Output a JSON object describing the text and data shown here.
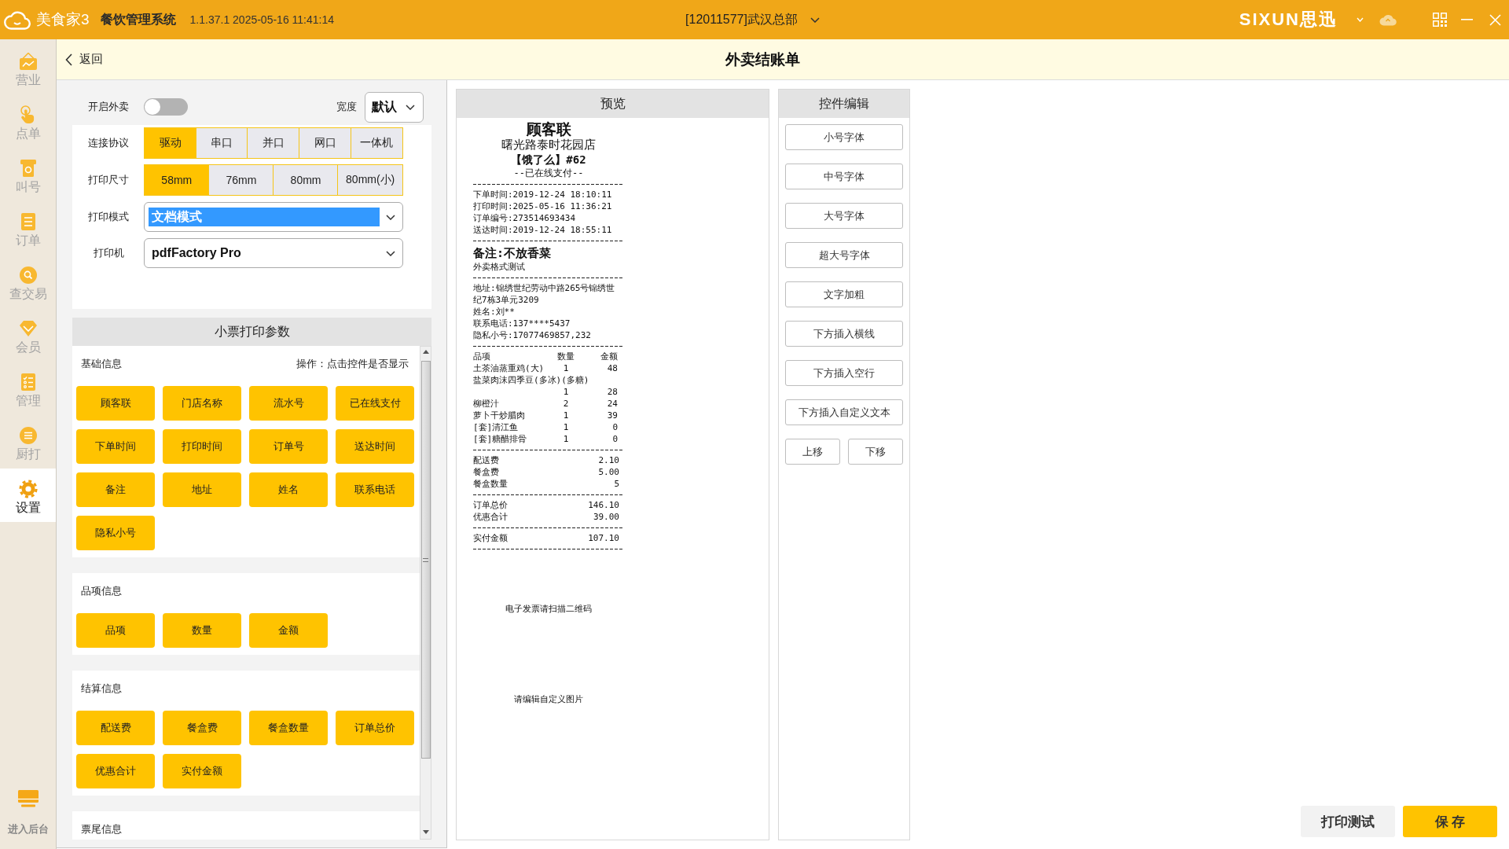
{
  "titlebar": {
    "app_name": "美食家3",
    "system_name": "餐饮管理系统",
    "version": "1.1.37.1 2025-05-16 11:41:14",
    "store": "[12011577]武汉总部",
    "brand": "SIXUN思迅"
  },
  "sidebar": {
    "items": [
      {
        "label": "营业",
        "selected": false
      },
      {
        "label": "点单",
        "selected": false
      },
      {
        "label": "叫号",
        "selected": false
      },
      {
        "label": "订单",
        "selected": false
      },
      {
        "label": "查交易",
        "selected": false
      },
      {
        "label": "会员",
        "selected": false
      },
      {
        "label": "管理",
        "selected": false
      },
      {
        "label": "厨打",
        "selected": false
      },
      {
        "label": "设置",
        "selected": true
      }
    ],
    "footer": {
      "label": "进入后台"
    }
  },
  "header": {
    "back": "返回",
    "title": "外卖结账单"
  },
  "settings": {
    "takeout": {
      "label": "开启外卖",
      "on": false
    },
    "width": {
      "label": "宽度",
      "value": "默认"
    },
    "protocol": {
      "label": "连接协议",
      "options": [
        {
          "label": "驱动",
          "selected": true
        },
        {
          "label": "串口",
          "selected": false
        },
        {
          "label": "并口",
          "selected": false
        },
        {
          "label": "网口",
          "selected": false
        },
        {
          "label": "一体机",
          "selected": false
        }
      ]
    },
    "size": {
      "label": "打印尺寸",
      "options": [
        {
          "label": "58mm",
          "selected": true
        },
        {
          "label": "76mm",
          "selected": false
        },
        {
          "label": "80mm",
          "selected": false
        },
        {
          "label": "80mm(小)",
          "selected": false
        }
      ]
    },
    "mode": {
      "label": "打印模式",
      "value": "文档模式",
      "highlighted": true
    },
    "printer": {
      "label": "打印机",
      "value": "pdfFactory Pro"
    }
  },
  "params": {
    "title": "小票打印参数",
    "groups": [
      {
        "title": "基础信息",
        "hint": "操作：点击控件是否显示",
        "buttons": [
          {
            "label": "顾客联",
            "on": true
          },
          {
            "label": "门店名称",
            "on": true
          },
          {
            "label": "流水号",
            "on": true
          },
          {
            "label": "已在线支付",
            "on": true
          },
          {
            "label": "下单时间",
            "on": true
          },
          {
            "label": "打印时间",
            "on": true
          },
          {
            "label": "订单号",
            "on": true
          },
          {
            "label": "送达时间",
            "on": true
          },
          {
            "label": "备注",
            "on": true
          },
          {
            "label": "地址",
            "on": true
          },
          {
            "label": "姓名",
            "on": true
          },
          {
            "label": "联系电话",
            "on": true
          },
          {
            "label": "隐私小号",
            "on": true
          }
        ]
      },
      {
        "title": "品项信息",
        "buttons": [
          {
            "label": "品项",
            "on": true
          },
          {
            "label": "数量",
            "on": true
          },
          {
            "label": "金额",
            "on": true
          }
        ]
      },
      {
        "title": "结算信息",
        "buttons": [
          {
            "label": "配送费",
            "on": true
          },
          {
            "label": "餐盒费",
            "on": true
          },
          {
            "label": "餐盒数量",
            "on": true
          },
          {
            "label": "订单总价",
            "on": true
          },
          {
            "label": "优惠合计",
            "on": true
          },
          {
            "label": "实付金额",
            "on": true
          }
        ]
      },
      {
        "title": "票尾信息"
      }
    ]
  },
  "preview": {
    "title": "预览",
    "receipt": {
      "title": "顾客联",
      "store": "曙光路泰时花园店",
      "platform": "【饿了么】#62",
      "payment": "--已在线支付--",
      "order_info": [
        "下单时间:2019-12-24 18:10:11",
        "打印时间:2025-05-16 11:36:21",
        "订单编号:273514693434",
        "送达时间:2019-12-24 18:55:11"
      ],
      "note": "备注:不放香菜",
      "note_detail": "外卖格式测试",
      "customer": [
        "地址:锦绣世纪劳动中路265号锦绣世",
        "纪7栋3单元3209",
        "姓名:刘**",
        "联系电话:137****5437",
        "隐私小号:17077469857,232"
      ],
      "items_header": [
        "品项",
        "数量",
        "金额"
      ],
      "items": [
        {
          "name": "土茶油蒸重鸡(大)",
          "qty": "1",
          "amount": "48",
          "kind": "inline"
        },
        {
          "name": "盐菜肉沫四季豆(多冰)(多糖)",
          "qty": "1",
          "amount": "28",
          "kind": "wrapped"
        },
        {
          "name": "柳橙汁",
          "qty": "2",
          "amount": "24",
          "kind": "inline"
        },
        {
          "name": "萝卜干炒腊肉",
          "qty": "1",
          "amount": "39",
          "kind": "inline"
        },
        {
          "name": "[套]清江鱼",
          "qty": "1",
          "amount": "0",
          "kind": "inline"
        },
        {
          "name": "[套]糖醋排骨",
          "qty": "1",
          "amount": "0",
          "kind": "inline"
        }
      ],
      "fees": [
        {
          "label": "配送费",
          "value": "2.10"
        },
        {
          "label": "餐盒费",
          "value": "5.00"
        },
        {
          "label": "餐盒数量",
          "value": "5"
        }
      ],
      "totals": [
        {
          "label": "订单总价",
          "value": "146.10"
        },
        {
          "label": "优惠合计",
          "value": "39.00"
        }
      ],
      "paid": {
        "label": "实付金额",
        "value": "107.10"
      },
      "qr_hint": "电子发票请扫描二维码",
      "image_hint": "请编辑自定义图片"
    }
  },
  "editor": {
    "title": "控件编辑",
    "buttons": [
      "小号字体",
      "中号字体",
      "大号字体",
      "超大号字体",
      "文字加粗",
      "下方插入横线",
      "下方插入空行",
      "下方插入自定义文本"
    ],
    "move_buttons": [
      "上移",
      "下移"
    ]
  },
  "actions": [
    {
      "label": "打印测试",
      "kind": "secondary"
    },
    {
      "label": "保 存",
      "kind": "primary"
    }
  ]
}
